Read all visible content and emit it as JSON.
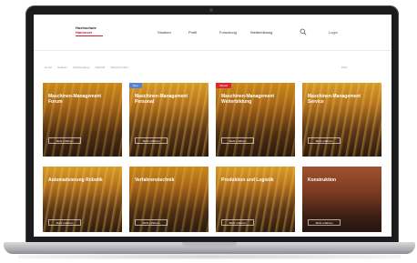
{
  "header": {
    "logo_line1": "Hochschule",
    "logo_line2": "Hannover",
    "nav": [
      "Studium",
      "Profil",
      "Forschung",
      "Weiterbildung"
    ],
    "login": "Login"
  },
  "breadcrumb": [
    "Home",
    "Studium",
    "Studiengänge",
    "Fakultät",
    "Maschinenbau"
  ],
  "breadcrumb_right": "Filter",
  "cards": [
    {
      "title": "Maschinen-Management Forum",
      "button": "Mehr erfahren",
      "badge": ""
    },
    {
      "title": "Maschinen-Management Personal",
      "button": "Mehr erfahren",
      "badge": "Neu"
    },
    {
      "title": "Maschinen-Management Weiterbildung",
      "button": "Mehr erfahren",
      "badge": "Aktuell"
    },
    {
      "title": "Maschinen-Management Service",
      "button": "Mehr erfahren",
      "badge": ""
    },
    {
      "title": "Automatisierung Robotik",
      "button": "Mehr erfahren",
      "badge": ""
    },
    {
      "title": "Verfahrenstechnik",
      "button": "Mehr erfahren",
      "badge": ""
    },
    {
      "title": "Produktion und Logistik",
      "button": "Mehr erfahren",
      "badge": ""
    },
    {
      "title": "Konstruktion",
      "button": "Mehr erfahren",
      "badge": ""
    }
  ],
  "colors": {
    "accent": "#d0202e",
    "badge_blue": "#5b7fd1",
    "badge_red": "#e0252f"
  }
}
